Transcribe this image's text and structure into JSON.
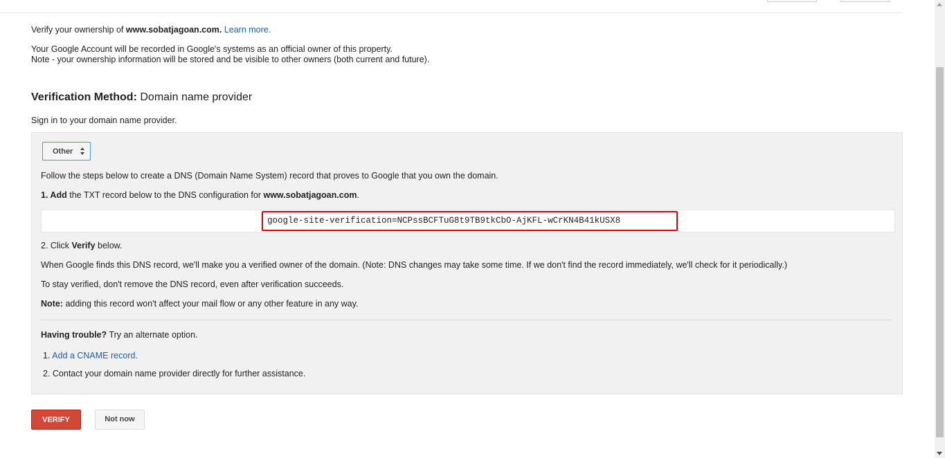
{
  "intro": {
    "verify_prefix": "Verify your ownership of",
    "domain": "www.sobatjagoan.com.",
    "learn_more": "Learn more.",
    "recorded_note": "Your Google Account will be recorded in Google's systems as an official owner of this property.",
    "visibility_note": "Note - your ownership information will be stored and be visible to other owners (both current and future)."
  },
  "method": {
    "label": "Verification Method:",
    "value": "Domain name provider"
  },
  "sign_in_text": "Sign in to your domain name provider.",
  "panel": {
    "provider_select": "Other",
    "follow_steps": "Follow the steps below to create a DNS (Domain Name System) record that proves to Google that you own the domain.",
    "step1": {
      "num_add": "1. Add",
      "text": "the TXT record below to the DNS configuration for",
      "domain": "www.sobatjagoan.com",
      "end": "."
    },
    "txt_record": "google-site-verification=NCPssBCFTuG8t9TB9tkCbO-AjKFL-wCrKN4B41kUSX8",
    "step2": {
      "prefix": "2. Click",
      "verify": "Verify",
      "suffix": "below."
    },
    "when_found": "When Google finds this DNS record, we'll make you a verified owner of the domain. (Note: DNS changes may take some time. If we don't find the record immediately, we'll check for it periodically.)",
    "stay_verified": "To stay verified, don't remove the DNS record, even after verification succeeds.",
    "note": {
      "label": "Note:",
      "text": "adding this record won't affect your mail flow or any other feature in any way."
    },
    "trouble": {
      "label": "Having trouble?",
      "text": "Try an alternate option."
    },
    "alt1": {
      "num": "1.",
      "link": "Add a CNAME record."
    },
    "alt2": "2. Contact your domain name provider directly for further assistance."
  },
  "buttons": {
    "verify": "VERIFY",
    "not_now": "Not now"
  },
  "colors": {
    "link": "#1a5fb4",
    "verify_button": "#d14836",
    "highlight_border": "#e00000",
    "panel_bg": "#f1f1f1"
  }
}
